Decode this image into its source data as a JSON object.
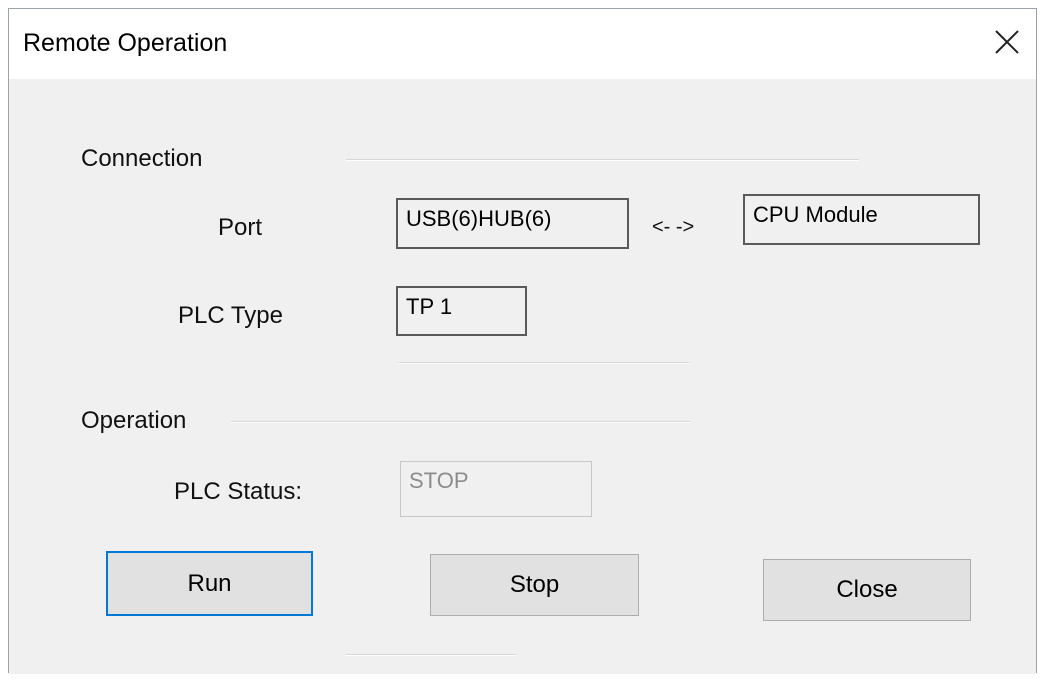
{
  "window": {
    "title": "Remote Operation",
    "close_icon": "close-icon"
  },
  "connection": {
    "heading": "Connection",
    "port_label": "Port",
    "port_value": "USB(6)HUB(6)",
    "arrow": "<- ->",
    "target_value": "CPU Module",
    "plc_type_label": "PLC Type",
    "plc_type_value": "TP 1"
  },
  "operation": {
    "heading": "Operation",
    "status_label": "PLC Status:",
    "status_value": "STOP"
  },
  "buttons": {
    "run": "Run",
    "stop": "Stop",
    "close": "Close"
  },
  "colors": {
    "window_bg": "#f0f0f0",
    "titlebar_bg": "#ffffff",
    "default_button_border": "#0078d7",
    "disabled_text": "#8c8c8c"
  }
}
